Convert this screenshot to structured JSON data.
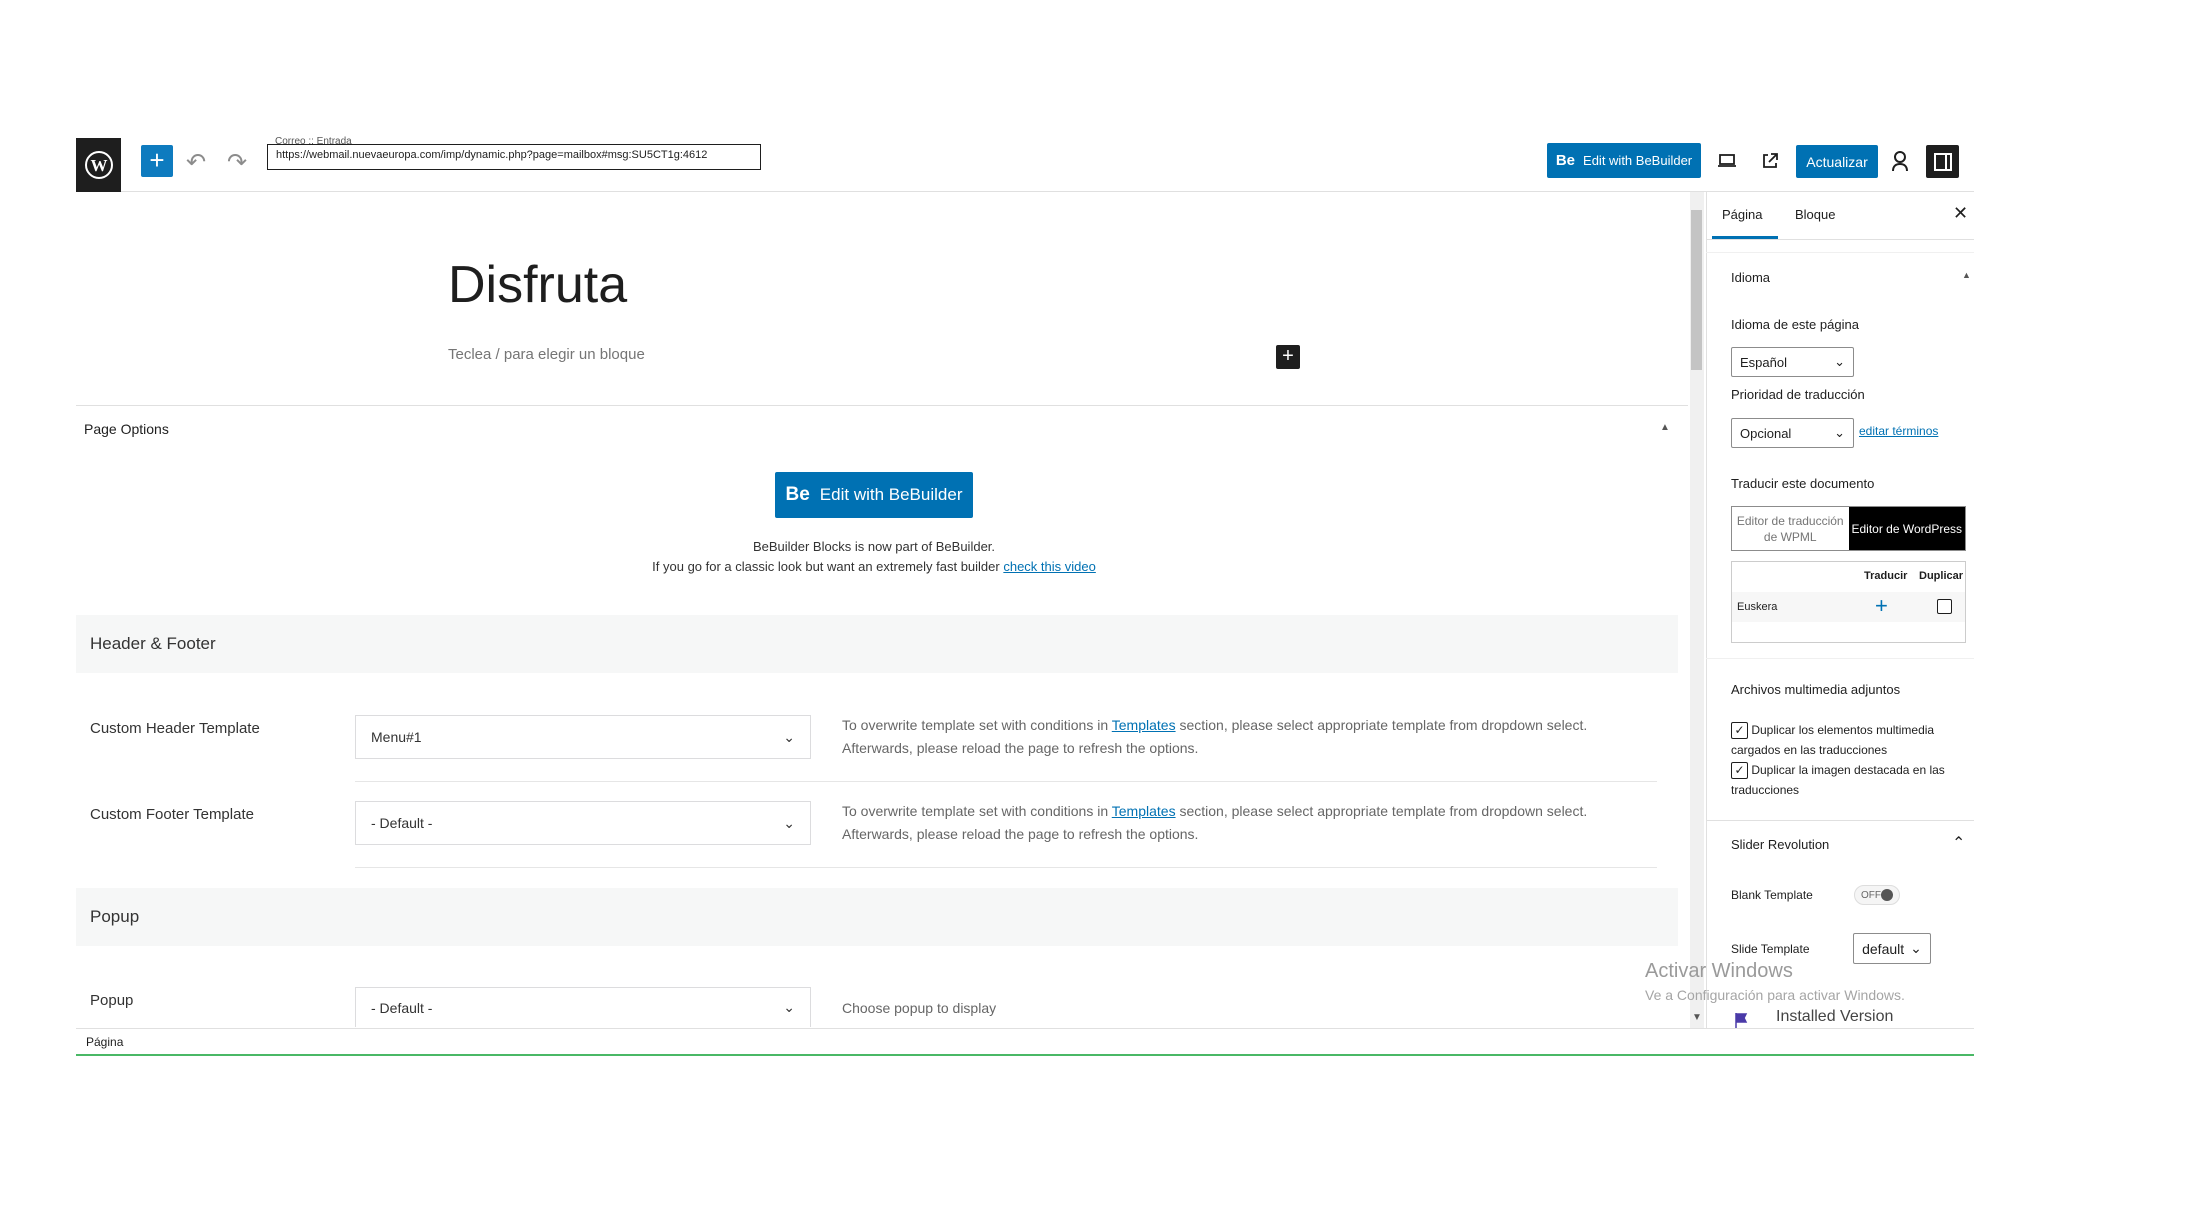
{
  "toolbar": {
    "url_crumb": "Correo :: Entrada",
    "url": "https://webmail.nuevaeuropa.com/imp/dynamic.php?page=mailbox#msg:SU5CT1g:4612",
    "bebuilder_prefix": "Be",
    "bebuilder_label": "Edit with BeBuilder",
    "update_label": "Actualizar"
  },
  "editor": {
    "title": "Disfruta",
    "placeholder": "Teclea / para elegir un bloque"
  },
  "page_options": {
    "heading": "Page Options",
    "bebuilder_prefix": "Be",
    "bebuilder_label": "Edit with BeBuilder",
    "info_line1": "BeBuilder Blocks is now part of BeBuilder.",
    "info_line2": "If you go for a classic look but want an extremely fast builder",
    "info_link": "check this video",
    "header_footer": {
      "title": "Header & Footer",
      "header_label": "Custom Header Template",
      "header_value": "Menu#1",
      "footer_label": "Custom Footer Template",
      "footer_value": "- Default -",
      "desc_pre": "To overwrite template set with conditions in",
      "desc_link": "Templates",
      "desc_post": "section, please select appropriate template from dropdown select.",
      "desc_line2": "Afterwards, please reload the page to refresh the options."
    },
    "popup": {
      "title": "Popup",
      "label": "Popup",
      "value": "- Default -",
      "desc": "Choose popup to display"
    }
  },
  "status_bar": {
    "label": "Página"
  },
  "sidebar": {
    "tabs": [
      "Página",
      "Bloque"
    ],
    "idioma": {
      "title": "Idioma",
      "lang_label": "Idioma de este página",
      "lang_value": "Español",
      "priority_label": "Prioridad de traducción",
      "priority_value": "Opcional",
      "edit_terms": "editar términos",
      "translate_label": "Traducir este documento",
      "seg_wpml": "Editor de traducción de WPML",
      "seg_wp": "Editor de WordPress",
      "col_translate": "Traducir",
      "col_duplicate": "Duplicar",
      "language_row": "Euskera"
    },
    "media": {
      "title": "Archivos multimedia adjuntos",
      "opt1": "Duplicar los elementos multimedia cargados en las traducciones",
      "opt2": "Duplicar la imagen destacada en las traducciones"
    },
    "slider": {
      "title": "Slider Revolution",
      "blank_label": "Blank Template",
      "blank_state": "OFF",
      "slide_label": "Slide Template",
      "slide_value": "default",
      "installed": "Installed Version"
    }
  },
  "watermark": {
    "line1": "Activar Windows",
    "line2": "Ve a Configuración para activar Windows."
  },
  "colors": {
    "accent": "#0071b3",
    "dark": "#1e1e1e",
    "green": "#4ab866"
  }
}
